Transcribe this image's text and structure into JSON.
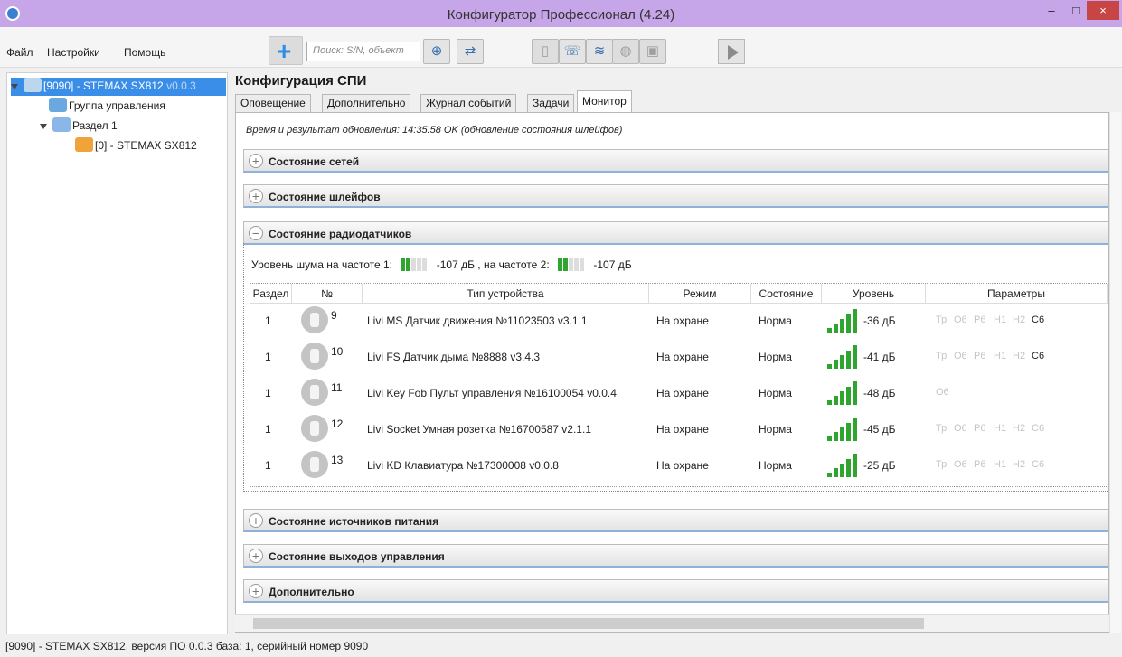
{
  "window": {
    "title": "Конфигуратор Профессионал (4.24)",
    "close": "×",
    "minimize": "–",
    "maximize": "□"
  },
  "menu": {
    "file": "Файл",
    "settings": "Настройки",
    "help": "Помощь"
  },
  "toolbar": {
    "search_placeholder": "Поиск: S/N, объект"
  },
  "tree": {
    "root": {
      "label": "[9090] - STEMAX SX812",
      "version": "v0.0.3"
    },
    "group": "Группа управления",
    "section": "Раздел 1",
    "device": "[0] - STEMAX SX812"
  },
  "main": {
    "title": "Конфигурация СПИ",
    "tabs": [
      "Оповещение",
      "Дополнительно",
      "Журнал событий",
      "Задачи",
      "Монитор"
    ],
    "update_text": "Время и результат обновления: 14:35:58 OK (обновление состояния шлейфов)",
    "sections": {
      "networks": "Состояние сетей",
      "loops": "Состояние шлейфов",
      "radio": "Состояние радиодатчиков",
      "power": "Состояние источников питания",
      "outputs": "Состояние выходов управления",
      "extra": "Дополнительно"
    },
    "noise": {
      "label1": "Уровень шума на частоте 1:",
      "value1": "-107 дБ",
      "label2": ", на частоте 2:",
      "value2": "-107 дБ"
    },
    "table": {
      "headers": [
        "Раздел",
        "№",
        "Тип устройства",
        "Режим",
        "Состояние",
        "Уровень",
        "Параметры"
      ],
      "rows": [
        {
          "section": "1",
          "num": "9",
          "type": "Livi MS Датчик движения №11023503 v3.1.1",
          "mode": "На охране",
          "state": "Норма",
          "level": "-36 дБ"
        },
        {
          "section": "1",
          "num": "10",
          "type": "Livi FS Датчик дыма №8888 v3.4.3",
          "mode": "На охране",
          "state": "Норма",
          "level": "-41 дБ"
        },
        {
          "section": "1",
          "num": "11",
          "type": "Livi Key Fob Пульт управления №16100054 v0.0.4",
          "mode": "На охране",
          "state": "Норма",
          "level": "-48 дБ"
        },
        {
          "section": "1",
          "num": "12",
          "type": "Livi Socket Умная розетка №16700587 v2.1.1",
          "mode": "На охране",
          "state": "Норма",
          "level": "-45 дБ"
        },
        {
          "section": "1",
          "num": "13",
          "type": "Livi KD Клавиатура №17300008 v0.0.8",
          "mode": "На охране",
          "state": "Норма",
          "level": "-25 дБ"
        }
      ],
      "params": {
        "tp": "Тр",
        "o6": "О6",
        "r6": "Р6",
        "n1": "Н1",
        "n2": "Н2",
        "s6": "С6"
      }
    }
  },
  "status": "[9090] - STEMAX SX812, версия ПО 0.0.3 база: 1, серийный номер 9090",
  "colors": {
    "titlebar": "#c6a6e8",
    "accent": "#3b8ee8",
    "signal": "#2ea52e",
    "close": "#c74545"
  }
}
